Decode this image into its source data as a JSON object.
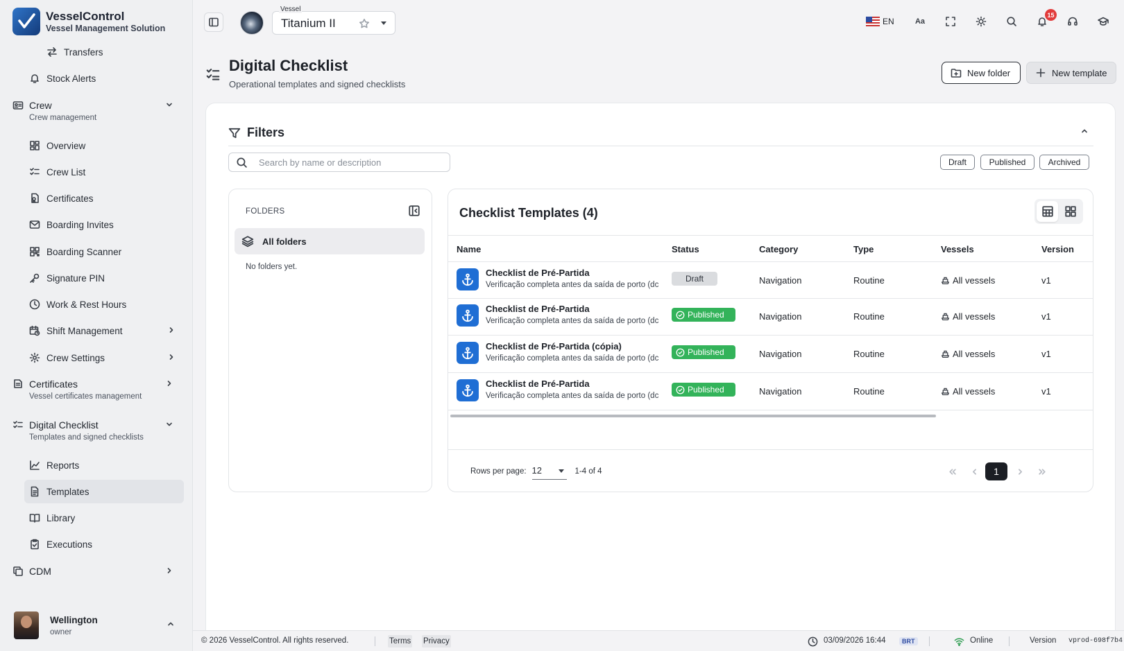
{
  "brand": {
    "name": "VesselControl",
    "subtitle": "Vessel Management Solution"
  },
  "sidebar": {
    "transfers": "Transfers",
    "stock_alerts": "Stock Alerts",
    "crew": {
      "label": "Crew",
      "sub": "Crew management"
    },
    "crew_items": [
      "Overview",
      "Crew List",
      "Certificates",
      "Boarding Invites",
      "Boarding Scanner",
      "Signature PIN",
      "Work & Rest Hours",
      "Shift Management",
      "Crew Settings"
    ],
    "certificates": {
      "label": "Certificates",
      "sub": "Vessel certificates management"
    },
    "digital_checklist": {
      "label": "Digital Checklist",
      "sub": "Templates and signed checklists"
    },
    "dc_items": [
      "Reports",
      "Templates",
      "Library",
      "Executions"
    ],
    "cdm": "CDM",
    "user": {
      "name": "Wellington",
      "role": "owner"
    }
  },
  "topbar": {
    "vessel_label": "Vessel",
    "vessel_name": "Titanium II",
    "language": "EN",
    "font_size_icon": "Aa",
    "notifications_count": "15"
  },
  "page": {
    "title": "Digital Checklist",
    "subtitle": "Operational templates and signed checklists",
    "new_folder": "New folder",
    "new_template": "New template"
  },
  "filters": {
    "title": "Filters",
    "search_placeholder": "Search by name or description",
    "chips": [
      "Draft",
      "Published",
      "Archived"
    ]
  },
  "folders": {
    "header": "FOLDERS",
    "all": "All folders",
    "empty": "No folders yet."
  },
  "templates": {
    "title": "Checklist Templates (4)",
    "columns": [
      "Name",
      "Status",
      "Category",
      "Type",
      "Vessels",
      "Version"
    ],
    "rows": [
      {
        "name": "Checklist de Pré-Partida",
        "desc": "Verificação completa antes da saída de porto (dc",
        "status": "Draft",
        "category": "Navigation",
        "type": "Routine",
        "vessels": "All vessels",
        "version": "v1"
      },
      {
        "name": "Checklist de Pré-Partida",
        "desc": "Verificação completa antes da saída de porto (dc",
        "status": "Published",
        "category": "Navigation",
        "type": "Routine",
        "vessels": "All vessels",
        "version": "v1"
      },
      {
        "name": "Checklist de Pré-Partida (cópia)",
        "desc": "Verificação completa antes da saída de porto (dc",
        "status": "Published",
        "category": "Navigation",
        "type": "Routine",
        "vessels": "All vessels",
        "version": "v1"
      },
      {
        "name": "Checklist de Pré-Partida",
        "desc": "Verificação completa antes da saída de porto (dc",
        "status": "Published",
        "category": "Navigation",
        "type": "Routine",
        "vessels": "All vessels",
        "version": "v1"
      }
    ],
    "pagination": {
      "rows_label": "Rows per page:",
      "rows_value": "12",
      "range": "1-4 of 4",
      "current_page": "1"
    }
  },
  "footer": {
    "copyright": "© 2026 VesselControl. All rights reserved.",
    "terms": "Terms",
    "privacy": "Privacy",
    "datetime": "03/09/2026 16:44",
    "timezone": "BRT",
    "status": "Online",
    "version_label": "Version",
    "version_value": "vprod-698f7b4"
  },
  "colors": {
    "accent": "#1f6ed4",
    "published": "#33b35a",
    "draft": "#dadcdf",
    "badge": "#e23b3b"
  }
}
